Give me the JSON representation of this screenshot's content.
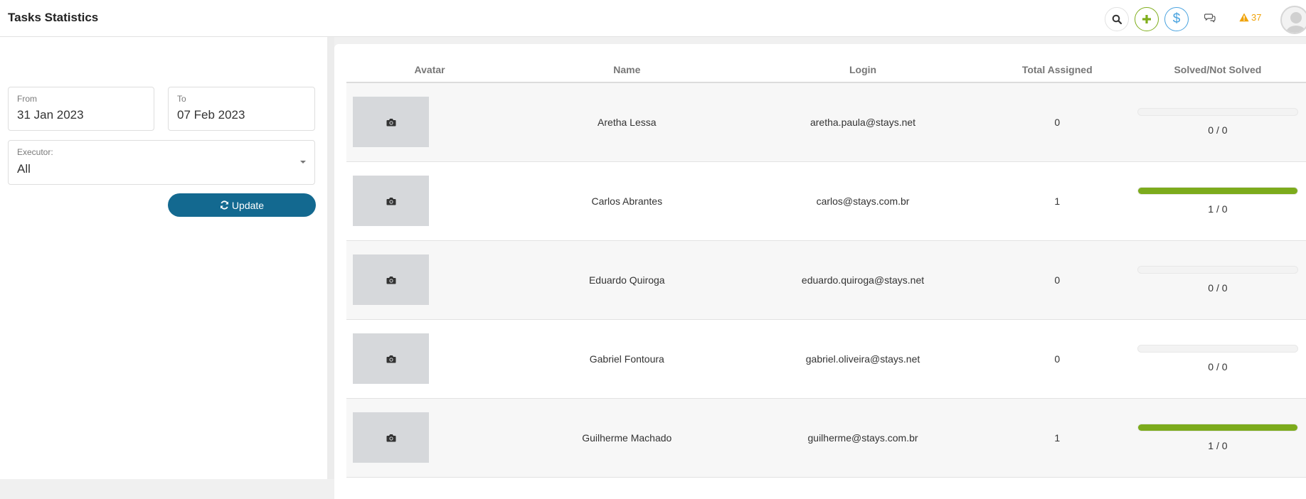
{
  "header": {
    "title": "Tasks Statistics",
    "alert_count": "37",
    "colors": {
      "add": "#7fae1b",
      "money": "#4aa3df",
      "alert": "#f0a30a"
    }
  },
  "filters": {
    "from_label": "From",
    "from_value": "31 Jan 2023",
    "to_label": "To",
    "to_value": "07 Feb 2023",
    "executor_label": "Executor:",
    "executor_value": "All",
    "update_label": "Update"
  },
  "table": {
    "columns": [
      "Avatar",
      "Name",
      "Login",
      "Total Assigned",
      "Solved/Not Solved"
    ],
    "rows": [
      {
        "name": "Aretha Lessa",
        "login": "aretha.paula@stays.net",
        "total": "0",
        "ratio": "0 / 0",
        "solved_fraction": 0
      },
      {
        "name": "Carlos Abrantes",
        "login": "carlos@stays.com.br",
        "total": "1",
        "ratio": "1 / 0",
        "solved_fraction": 1
      },
      {
        "name": "Eduardo Quiroga",
        "login": "eduardo.quiroga@stays.net",
        "total": "0",
        "ratio": "0 / 0",
        "solved_fraction": 0
      },
      {
        "name": "Gabriel Fontoura",
        "login": "gabriel.oliveira@stays.net",
        "total": "0",
        "ratio": "0 / 0",
        "solved_fraction": 0
      },
      {
        "name": "Guilherme Machado",
        "login": "guilherme@stays.com.br",
        "total": "1",
        "ratio": "1 / 0",
        "solved_fraction": 1
      }
    ]
  }
}
